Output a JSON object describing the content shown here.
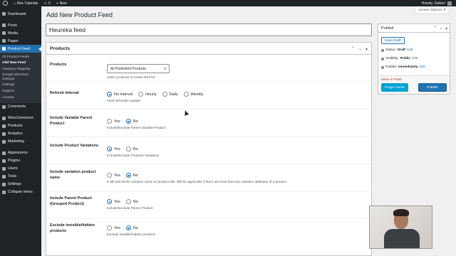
{
  "adminbar": {
    "site_name": "Rex Tutorials",
    "comments_count": "0",
    "new_label": "New",
    "howdy": "Howdy, Sultan!"
  },
  "sidebar": {
    "items_top": [
      {
        "label": "Dashboard",
        "icon": "dashboard-icon"
      }
    ],
    "items_mid": [
      {
        "label": "Posts",
        "icon": "pin-icon"
      },
      {
        "label": "Media",
        "icon": "media-icon"
      },
      {
        "label": "Pages",
        "icon": "page-icon"
      }
    ],
    "active": {
      "label": "Product Feed",
      "icon": "feed-icon"
    },
    "submenu": [
      "All Product Feeds",
      "Add New Feed",
      "Category Mapping",
      "Google Merchant Settings",
      "Settings",
      "Support",
      "License"
    ],
    "submenu_current_index": 1,
    "items_bottom": [
      {
        "label": "Comments",
        "icon": "comments-icon"
      },
      {
        "label": "WooCommerce",
        "icon": "woocommerce-icon"
      },
      {
        "label": "Products",
        "icon": "products-icon"
      },
      {
        "label": "Analytics",
        "icon": "analytics-icon"
      },
      {
        "label": "Marketing",
        "icon": "marketing-icon"
      },
      {
        "label": "Appearance",
        "icon": "appearance-icon"
      },
      {
        "label": "Plugins",
        "icon": "plugins-icon"
      },
      {
        "label": "Users",
        "icon": "users-icon"
      },
      {
        "label": "Tools",
        "icon": "tools-icon"
      },
      {
        "label": "Settings",
        "icon": "settings-icon"
      },
      {
        "label": "Collapse menu",
        "icon": "collapse-icon"
      }
    ]
  },
  "screen_options": "Screen Options",
  "page_title": "Add New Product Feed",
  "feed_title_value": "Heureka feed",
  "products_box": {
    "title": "Products",
    "products_label": "Products",
    "products_select": "All Published Products",
    "products_desc": "Select products to create feed for.",
    "refresh_label": "Refresh Interval",
    "refresh_options": [
      "No Interval",
      "Hourly",
      "Daily",
      "Weekly"
    ],
    "refresh_selected": 0,
    "refresh_desc": "Feed Schedule Update",
    "rows": [
      {
        "label": "Include Variable Parent Product",
        "yes": "Yes",
        "no": "No",
        "selected": "no",
        "desc": "Include/Exclude Parent Variable Product"
      },
      {
        "label": "Include Product Variations",
        "yes": "Yes",
        "no": "No",
        "selected": "yes",
        "desc": "Include/Exclude Products Variations"
      },
      {
        "label": "Include variation product name",
        "yes": "Yes",
        "no": "No",
        "selected": "no",
        "desc": "It will add all the variation name on product title. Will be applicable if there are more than two variation attributes of a product."
      },
      {
        "label": "Include Parent Product (Grouped Product)",
        "yes": "Yes",
        "no": "No",
        "selected": "yes",
        "desc": "Include/Exclude Parent Product"
      },
      {
        "label": "Exclude invisible/hidden products",
        "yes": "Yes",
        "no": "No",
        "selected": "no",
        "desc": "Exclude invisible/hidden products"
      }
    ]
  },
  "publish": {
    "title": "Publish",
    "save_draft": "Save Draft",
    "status_label": "Status:",
    "status_value": "Draft",
    "visibility_label": "Visibility:",
    "visibility_value": "Public",
    "publish_label": "Publish",
    "publish_value": "immediately",
    "edit": "Edit",
    "trash": "Move to Trash",
    "purge": "Purge Cache",
    "publish_button": "Publish"
  }
}
